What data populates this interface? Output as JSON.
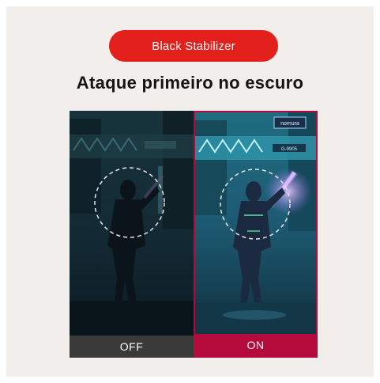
{
  "badge": {
    "label": "Black Stabilizer"
  },
  "headline": "Ataque primeiro no escuro",
  "comparison": {
    "off_label": "OFF",
    "on_label": "ON",
    "sign_text": "nomura",
    "sign_code": "G-9905"
  },
  "colors": {
    "badge_red": "#e3201b",
    "on_bar": "#b50a3c",
    "off_bar": "#3a3a3a",
    "background": "#f1eeeb"
  }
}
